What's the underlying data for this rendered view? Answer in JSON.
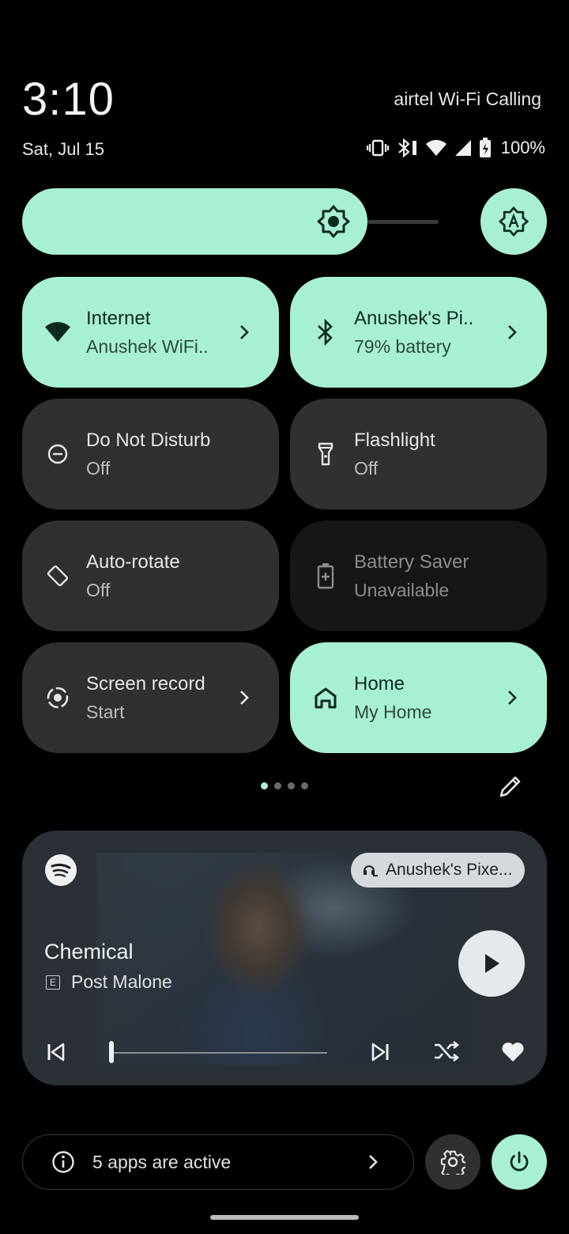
{
  "status_bar": {
    "time": "3:10",
    "date": "Sat, Jul 15",
    "carrier": "airtel Wi-Fi Calling",
    "battery_percent": "100%",
    "icons": [
      "vibrate-icon",
      "bluetooth-battery-icon",
      "wifi-icon",
      "signal-icon",
      "battery-charging-icon"
    ]
  },
  "brightness": {
    "level": 0.83,
    "auto_icon": "auto-brightness-icon"
  },
  "tiles": [
    {
      "title": "Internet",
      "subtitle": "Anushek WiFi..",
      "state": "on",
      "icon": "wifi-icon",
      "has_chevron": true
    },
    {
      "title": "Anushek's Pi..",
      "subtitle": "79% battery",
      "state": "on",
      "icon": "bluetooth-icon",
      "has_chevron": true
    },
    {
      "title": "Do Not Disturb",
      "subtitle": "Off",
      "state": "off",
      "icon": "do-not-disturb-icon",
      "has_chevron": false
    },
    {
      "title": "Flashlight",
      "subtitle": "Off",
      "state": "off",
      "icon": "flashlight-icon",
      "has_chevron": false
    },
    {
      "title": "Auto-rotate",
      "subtitle": "Off",
      "state": "off",
      "icon": "auto-rotate-icon",
      "has_chevron": false
    },
    {
      "title": "Battery Saver",
      "subtitle": "Unavailable",
      "state": "disabled",
      "icon": "battery-saver-icon",
      "has_chevron": false
    },
    {
      "title": "Screen record",
      "subtitle": "Start",
      "state": "off",
      "icon": "screen-record-icon",
      "has_chevron": true
    },
    {
      "title": "Home",
      "subtitle": "My Home",
      "state": "on",
      "icon": "home-icon",
      "has_chevron": true
    }
  ],
  "pager": {
    "pages": 4,
    "active": 0
  },
  "media": {
    "app_icon": "spotify-icon",
    "output_device": "Anushek's Pixe...",
    "song_title": "Chemical",
    "artist": "Post Malone",
    "explicit_badge": "E",
    "progress": 0.0
  },
  "footer": {
    "active_apps_label": "5 apps are active"
  },
  "colors": {
    "accent": "#a8f0d2",
    "tile_off": "#303030",
    "tile_disabled": "#161616",
    "background": "#000000"
  }
}
